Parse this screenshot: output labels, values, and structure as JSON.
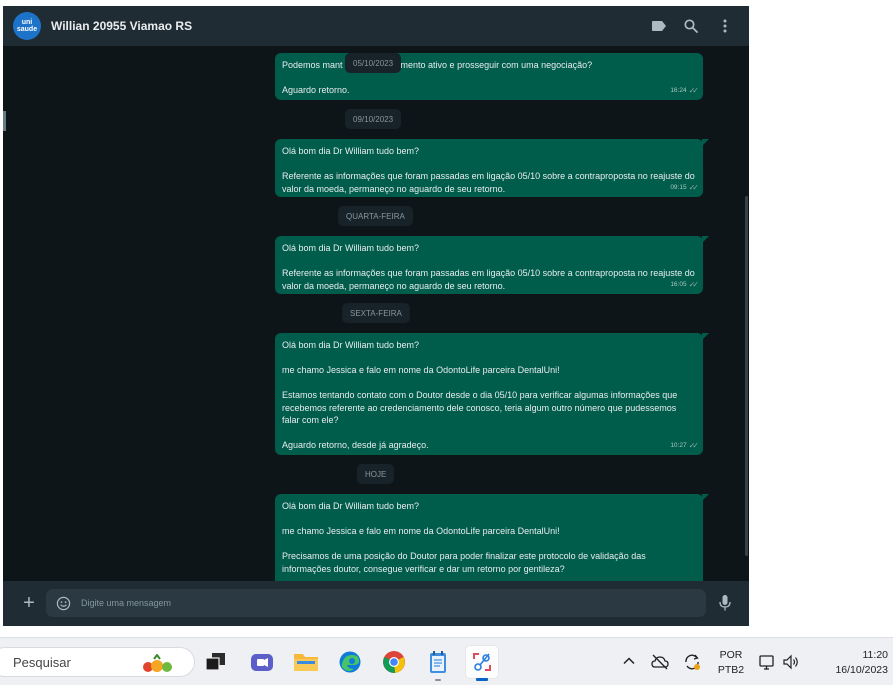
{
  "header": {
    "avatar_line1": "uni",
    "avatar_line2": "saude",
    "contact_name": "Willian 20955 Viamao RS"
  },
  "messages": [
    {
      "lines": [
        "Podemos mant",
        "mento ativo e prosseguir com uma negociação?",
        "",
        "Aguardo retorno."
      ],
      "time": "16:24",
      "overlay_chip": "05/10/2023"
    },
    {
      "date_chip": "09/10/2023"
    },
    {
      "lines": [
        "Olá bom dia Dr William tudo bem?",
        "",
        "Referente as informações que foram passadas em ligação 05/10 sobre a contraproposta no reajuste do valor da moeda, permaneço no aguardo de seu retorno."
      ],
      "time": "09:15"
    },
    {
      "date_chip": "QUARTA-FEIRA"
    },
    {
      "lines": [
        "Olá bom dia Dr William tudo bem?",
        "",
        "Referente as informações que foram passadas em ligação 05/10 sobre a contraproposta no reajuste do valor da moeda, permaneço no aguardo de seu retorno."
      ],
      "time": "16:05"
    },
    {
      "date_chip": "SEXTA-FEIRA"
    },
    {
      "lines": [
        "Olá bom dia Dr William tudo bem?",
        "",
        "me chamo Jessica e falo em nome da OdontoLife parceira DentalUni!",
        "",
        "Estamos tentando contato com o Doutor desde o dia 05/10 para verificar algumas informações que recebemos referente ao credenciamento dele conosco, teria algum outro número que pudessemos falar com ele?",
        "",
        "Aguardo retorno, desde já agradeço."
      ],
      "time": "10:27"
    },
    {
      "date_chip": "HOJE"
    },
    {
      "lines": [
        "Olá bom dia Dr William tudo bem?",
        "",
        "me chamo Jessica e falo em nome da OdontoLife parceira DentalUni!",
        "",
        "Precisamos de uma posição do Doutor para poder finalizar este protocolo de validação das informações doutor, consegue verificar e dar um retorno por gentileza?"
      ],
      "time": ""
    }
  ],
  "composer": {
    "placeholder": "Digite uma mensagem"
  },
  "taskbar": {
    "search_text": "Pesquisar",
    "lang_line1": "POR",
    "lang_line2": "PTB2",
    "time": "11:20",
    "date": "16/10/2023"
  },
  "colors": {
    "bubble_out": "#005c4b",
    "chat_bg": "#0b141a",
    "header_bg": "#202c33",
    "date_chip_bg": "#182229"
  },
  "icons": [
    "label-icon",
    "search-icon",
    "menu-dots-icon",
    "plus-icon",
    "emoji-icon",
    "mic-icon",
    "windows-search-icon",
    "task-view-icon",
    "teams-icon",
    "file-explorer-icon",
    "edge-icon",
    "chrome-icon",
    "notepad-icon",
    "snipping-tool-icon",
    "tray-chevron-icon",
    "cloud-offline-icon",
    "sync-icon",
    "monitor-icon",
    "speaker-icon"
  ]
}
